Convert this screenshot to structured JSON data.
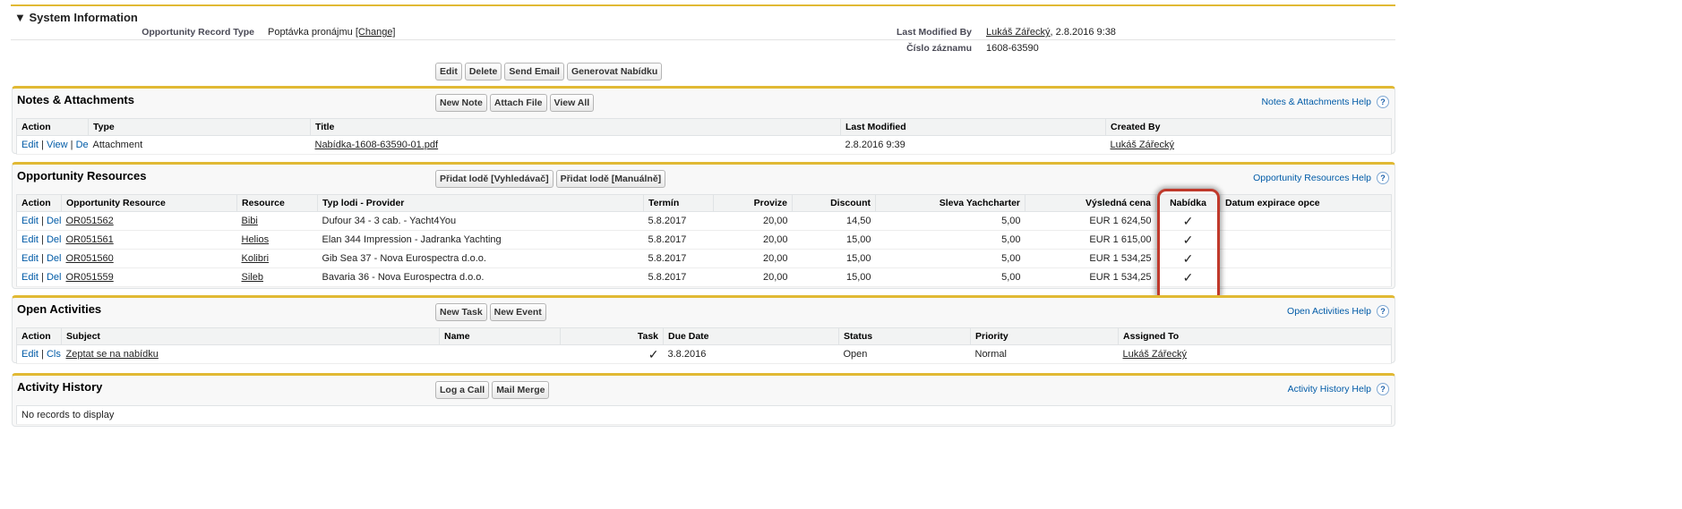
{
  "system": {
    "title": "System Information",
    "record_type_label": "Opportunity Record Type",
    "record_type_value": "Poptávka pronájmu",
    "change_link": "[Change]",
    "last_modified_label": "Last Modified By",
    "last_modified_user": "Lukáš Zářecký",
    "last_modified_date": ", 2.8.2016 9:38",
    "record_no_label": "Číslo záznamu",
    "record_no_value": "1608-63590"
  },
  "buttons": [
    "Edit",
    "Delete",
    "Send Email",
    "Generovat Nabídku"
  ],
  "notes": {
    "title": "Notes & Attachments",
    "buttons": [
      "New Note",
      "Attach File",
      "View All"
    ],
    "help": "Notes & Attachments Help",
    "columns": [
      "Action",
      "Type",
      "Title",
      "Last Modified",
      "Created By"
    ],
    "rows": [
      {
        "actions": [
          "Edit",
          "View",
          "Del"
        ],
        "type": "Attachment",
        "title": "Nabídka-1608-63590-01.pdf",
        "modified": "2.8.2016 9:39",
        "created_by": "Lukáš Zářecký"
      }
    ]
  },
  "resources": {
    "title": "Opportunity Resources",
    "buttons": [
      "Přidat lodě [Vyhledávač]",
      "Přidat lodě [Manuálně]"
    ],
    "help": "Opportunity Resources Help",
    "columns": [
      "Action",
      "Opportunity Resource",
      "Resource",
      "Typ lodi - Provider",
      "Termín",
      "Provize",
      "Discount",
      "Sleva Yachcharter",
      "Výsledná cena",
      "Nabídka",
      "Datum expirace opce"
    ],
    "rows": [
      {
        "actions": [
          "Edit",
          "Del"
        ],
        "id": "OR051562",
        "resource": "Bibi",
        "type": "Dufour 34 - 3 cab. - Yacht4You",
        "term": "5.8.2017",
        "provize": "20,00",
        "discount": "14,50",
        "sleva": "5,00",
        "price": "EUR 1 624,50",
        "nabidka": "✓",
        "expiry": ""
      },
      {
        "actions": [
          "Edit",
          "Del"
        ],
        "id": "OR051561",
        "resource": "Helios",
        "type": "Elan 344 Impression - Jadranka Yachting",
        "term": "5.8.2017",
        "provize": "20,00",
        "discount": "15,00",
        "sleva": "5,00",
        "price": "EUR 1 615,00",
        "nabidka": "✓",
        "expiry": ""
      },
      {
        "actions": [
          "Edit",
          "Del"
        ],
        "id": "OR051560",
        "resource": "Kolibri",
        "type": "Gib Sea 37 - Nova Eurospectra d.o.o.",
        "term": "5.8.2017",
        "provize": "20,00",
        "discount": "15,00",
        "sleva": "5,00",
        "price": "EUR 1 534,25",
        "nabidka": "✓",
        "expiry": ""
      },
      {
        "actions": [
          "Edit",
          "Del"
        ],
        "id": "OR051559",
        "resource": "Sileb",
        "type": "Bavaria 36 - Nova Eurospectra d.o.o.",
        "term": "5.8.2017",
        "provize": "20,00",
        "discount": "15,00",
        "sleva": "5,00",
        "price": "EUR 1 534,25",
        "nabidka": "✓",
        "expiry": ""
      }
    ]
  },
  "activities": {
    "title": "Open Activities",
    "buttons": [
      "New Task",
      "New Event"
    ],
    "help": "Open Activities Help",
    "columns": [
      "Action",
      "Subject",
      "Name",
      "Task",
      "Due Date",
      "Status",
      "Priority",
      "Assigned To"
    ],
    "rows": [
      {
        "actions": [
          "Edit",
          "Cls"
        ],
        "subject": "Zeptat se na nabídku",
        "name": "",
        "task": "✓",
        "due": "3.8.2016",
        "status": "Open",
        "priority": "Normal",
        "assigned": "Lukáš Zářecký"
      }
    ]
  },
  "history": {
    "title": "Activity History",
    "buttons": [
      "Log a Call",
      "Mail Merge"
    ],
    "help": "Activity History Help",
    "empty": "No records to display"
  },
  "colors": {
    "accent": "#e1b934",
    "highlight": "#c0392b",
    "link": "#015ba7"
  }
}
